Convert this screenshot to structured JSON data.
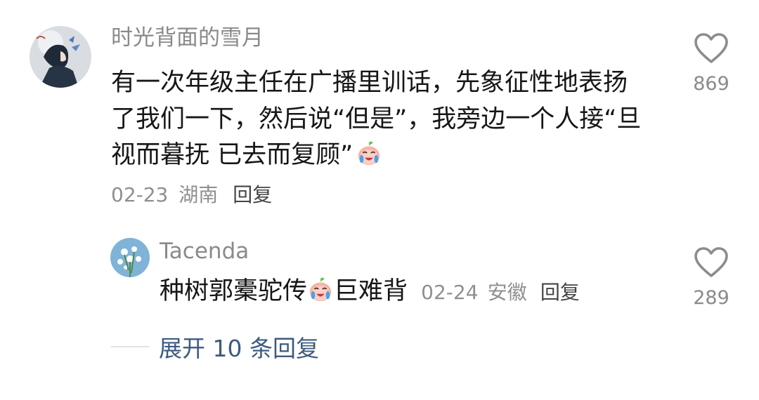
{
  "comment": {
    "avatar_icon": "user-avatar-illustration",
    "username": "时光背面的雪月",
    "text": "有一次年级主任在广播里训话，先象征性地表扬了我们一下，然后说“但是”，我旁边一个人接“旦视而暮抚 已去而复顾”",
    "emoji": "crying-laughing-sticker",
    "date": "02-23",
    "location": "湖南",
    "reply_label": "回复",
    "like_icon": "heart-outline-icon",
    "like_count": "869"
  },
  "reply": {
    "avatar_icon": "flower-avatar",
    "username": "Tacenda",
    "text_before": "种树郭橐驼传",
    "emoji": "crying-laughing-sticker",
    "text_after": "巨难背",
    "date": "02-24",
    "location": "安徽",
    "reply_label": "回复",
    "like_icon": "heart-outline-icon",
    "like_count": "289"
  },
  "expand": {
    "label": "展开 10 条回复"
  },
  "colors": {
    "username": "#8a8a8a",
    "text": "#161616",
    "meta": "#8f8f8f",
    "expand": "#3d5a80",
    "heart": "#8c8c8c"
  }
}
